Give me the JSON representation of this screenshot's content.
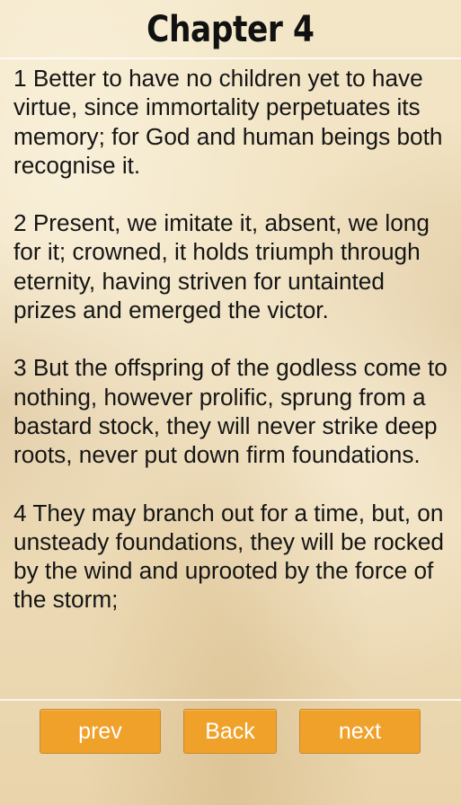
{
  "header": {
    "title": "Chapter 4"
  },
  "verses": [
    "1 Better to have no children yet to have virtue, since immortality perpetuates its memory; for God and human beings both recognise it.",
    "2 Present, we imitate it, absent, we long for it; crowned, it holds triumph through eternity, having striven for untainted prizes and emerged the victor.",
    "3 But the offspring of the godless come to nothing, however prolific, sprung from a bastard stock, they will never strike deep roots, never put down firm foundations.",
    "4 They may branch out for a time, but, on unsteady foundations, they will be rocked by the wind and uprooted by the force of the storm;"
  ],
  "nav": {
    "prev_label": "prev",
    "back_label": "Back",
    "next_label": "next"
  },
  "colors": {
    "button_bg": "#f0a12a",
    "button_text": "#ffffff",
    "text": "#151515",
    "parchment": "#f0e2c2"
  }
}
